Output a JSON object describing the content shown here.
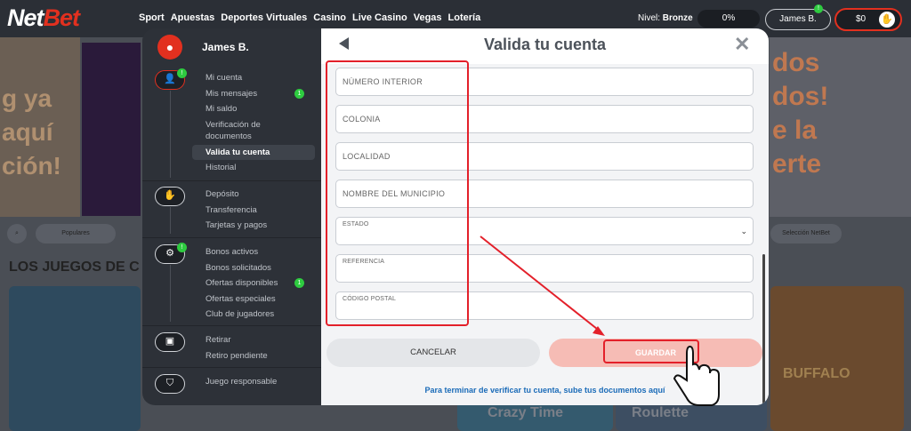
{
  "topbar": {
    "logo_net": "Net",
    "logo_bet": "Bet",
    "nav": [
      "Sport",
      "Apuestas",
      "Deportes Virtuales",
      "Casino",
      "Live Casino",
      "Vegas",
      "Lotería"
    ],
    "level_label": "Nivel:",
    "level_value": "Bronze",
    "progress_percent": "0%",
    "user_name": "James B.",
    "user_badge": "!",
    "balance": "$0"
  },
  "background": {
    "promo_left_text": "g ya\naquí\nción!",
    "promo_right_text": "dos\ndos!\ne la\nerte",
    "chips": [
      "Populares",
      "Selección NetBet"
    ],
    "section_heading": "LOS JUEGOS DE C",
    "tile_texts": [
      "Crazy Time",
      "Roulette",
      "BUFFALO"
    ]
  },
  "sidebar": {
    "user_name": "James B.",
    "groups": [
      {
        "icon": "user-icon",
        "badge": "!",
        "items": [
          {
            "label": "Mi cuenta",
            "badge": ""
          },
          {
            "label": "Mis mensajes",
            "badge": "1"
          },
          {
            "label": "Mi saldo",
            "badge": ""
          },
          {
            "label": "Verificación de documentos",
            "badge": ""
          },
          {
            "label": "Valida tu cuenta",
            "badge": "",
            "selected": true
          },
          {
            "label": "Historial",
            "badge": ""
          }
        ]
      },
      {
        "icon": "wallet-icon",
        "badge": "",
        "items": [
          {
            "label": "Depósito",
            "badge": ""
          },
          {
            "label": "Transferencia",
            "badge": ""
          },
          {
            "label": "Tarjetas y pagos",
            "badge": ""
          }
        ]
      },
      {
        "icon": "gift-icon",
        "badge": "!",
        "items": [
          {
            "label": "Bonos activos",
            "badge": ""
          },
          {
            "label": "Bonos solicitados",
            "badge": ""
          },
          {
            "label": "Ofertas disponibles",
            "badge": "1"
          },
          {
            "label": "Ofertas especiales",
            "badge": ""
          },
          {
            "label": "Club de jugadores",
            "badge": ""
          }
        ]
      },
      {
        "icon": "withdraw-icon",
        "badge": "",
        "items": [
          {
            "label": "Retirar",
            "badge": ""
          },
          {
            "label": "Retiro pendiente",
            "badge": ""
          }
        ]
      },
      {
        "icon": "shield-icon",
        "badge": "",
        "items": [
          {
            "label": "Juego responsable",
            "badge": ""
          }
        ]
      }
    ]
  },
  "panel": {
    "title": "Valida tu cuenta",
    "fields": {
      "numero_interior": {
        "placeholder": "NÚMERO INTERIOR"
      },
      "colonia": {
        "placeholder": "COLONIA"
      },
      "localidad": {
        "placeholder": "LOCALIDAD"
      },
      "municipio": {
        "placeholder": "NOMBRE DEL MUNICIPIO"
      },
      "estado": {
        "label": "ESTADO",
        "value": ""
      },
      "referencia": {
        "label": "REFERENCIA",
        "value": ""
      },
      "codigo_postal": {
        "label": "CÓDIGO POSTAL",
        "value": ""
      }
    },
    "cancel_label": "CANCELAR",
    "save_label": "GUARDAR",
    "footer_note": "Para terminar de verificar tu cuenta, sube tus documentos aquí"
  },
  "colors": {
    "brand_red": "#e2301f",
    "badge_green": "#2ecc40",
    "save_button": "#f6bcb5",
    "annotation_red": "#e3202a",
    "link_blue": "#1a6bb8"
  }
}
